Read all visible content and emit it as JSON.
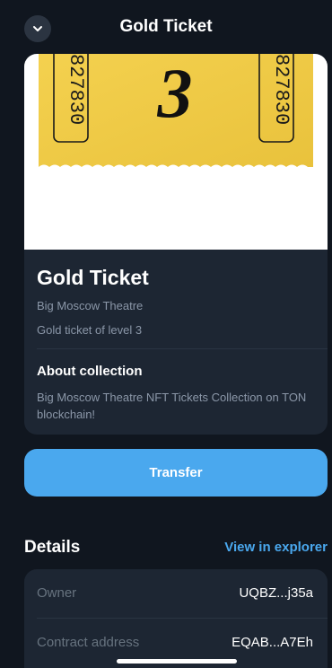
{
  "header": {
    "title": "Gold Ticket",
    "back_icon": "chevron-down-icon"
  },
  "nft": {
    "image_serial_left": "827830",
    "image_serial_right": "827830",
    "image_number": "3",
    "name": "Gold Ticket",
    "collection": "Big Moscow Theatre",
    "description": "Gold ticket of level 3",
    "about_title": "About collection",
    "about_text": "Big Moscow Theatre NFT Tickets Collection on TON blockchain!"
  },
  "actions": {
    "transfer_label": "Transfer"
  },
  "details": {
    "title": "Details",
    "explorer_link": "View in explorer",
    "rows": [
      {
        "label": "Owner",
        "value": "UQBZ...j35a"
      },
      {
        "label": "Contract address",
        "value": "EQAB...A7Eh"
      }
    ]
  },
  "colors": {
    "background": "#10161f",
    "card": "#1d2633",
    "accent": "#4aa8ee",
    "ticket_yellow": "#f2cf47",
    "muted_text": "#8b97a8"
  }
}
